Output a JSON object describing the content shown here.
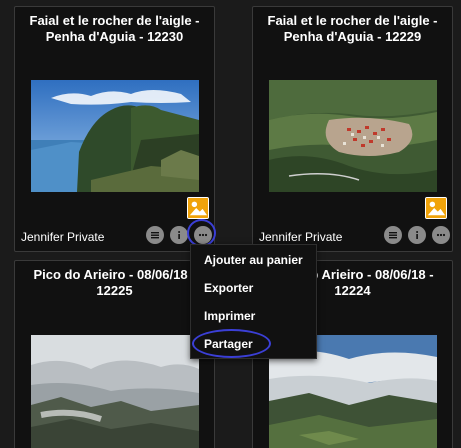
{
  "cards": [
    {
      "title_line1": "Faial et le rocher de l'aigle -",
      "title_line2": "Penha d'Aguia - 12230",
      "owner": "Jennifer Private"
    },
    {
      "title_line1": "Faial et le rocher de l'aigle -",
      "title_line2": "Penha d'Aguia - 12229",
      "owner": "Jennifer Private"
    },
    {
      "title_line1": "Pico do Arieiro - 08/06/18 -",
      "title_line2": "12225"
    },
    {
      "title_line1": "Pico do Arieiro - 08/06/18 -",
      "title_line2": "12224"
    }
  ],
  "icons": {
    "photo_badge": "image-icon",
    "list": "list-icon",
    "info": "info-icon",
    "more": "more-dots-icon"
  },
  "context_menu": {
    "items": [
      "Ajouter au panier",
      "Exporter",
      "Imprimer",
      "Partager"
    ]
  },
  "colors": {
    "background": "#1b1b1b",
    "card": "#111111",
    "badge": "#f0a30a",
    "highlight_ring": "#3b3fd6",
    "button": "#8a8a8a"
  }
}
